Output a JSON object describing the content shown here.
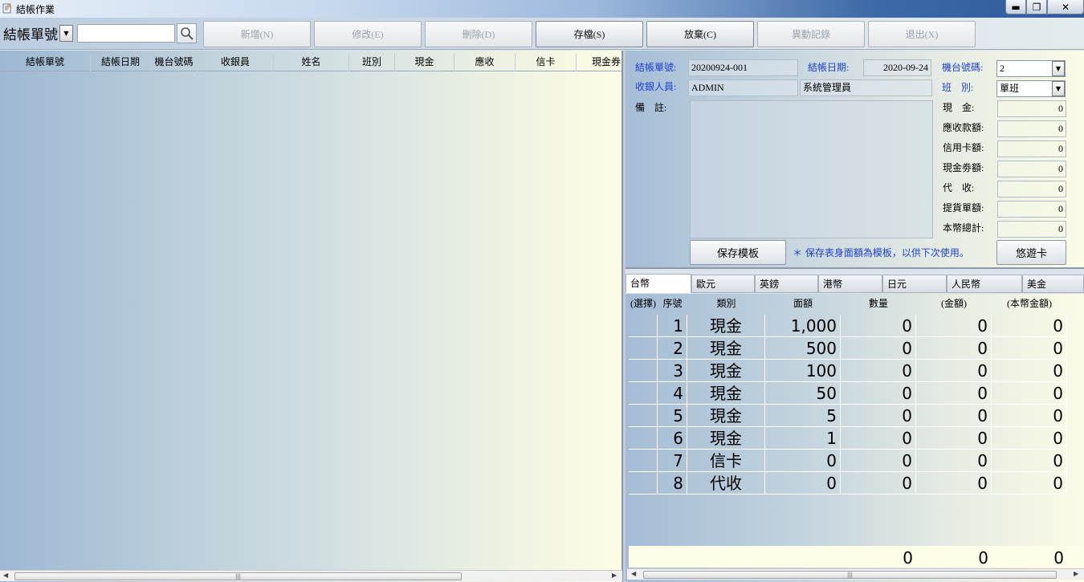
{
  "window": {
    "title": "結帳作業"
  },
  "toolbar": {
    "search_field": "結帳單號",
    "search_value": "",
    "buttons": [
      {
        "label": "新增(N)",
        "enabled": false
      },
      {
        "label": "修改(E)",
        "enabled": false
      },
      {
        "label": "刪除(D)",
        "enabled": false
      },
      {
        "label": "存檔(S)",
        "enabled": true
      },
      {
        "label": "放棄(C)",
        "enabled": true
      },
      {
        "label": "異動記錄",
        "enabled": false
      },
      {
        "label": "退出(X)",
        "enabled": false
      }
    ]
  },
  "list": {
    "columns": [
      "結帳單號",
      "結帳日期",
      "機台號碼",
      "收銀員",
      "姓名",
      "班別",
      "現金",
      "應收",
      "信卡",
      "現金券"
    ]
  },
  "form": {
    "bill_no_label": "結帳單號:",
    "bill_no": "20200924-001",
    "date_label": "結帳日期:",
    "date": "2020-09-24",
    "machine_label": "機台號碼:",
    "machine": "2",
    "cashier_label": "收銀人員:",
    "cashier_id": "ADMIN",
    "cashier_name": "系統管理員",
    "shift_label": "班　別:",
    "shift": "單班",
    "memo_label": "備　註:",
    "memo": "",
    "totals": [
      {
        "label": "現　金:",
        "value": "0"
      },
      {
        "label": "應收款額:",
        "value": "0"
      },
      {
        "label": "信用卡額:",
        "value": "0"
      },
      {
        "label": "現金劵額:",
        "value": "0"
      },
      {
        "label": "代　收:",
        "value": "0"
      },
      {
        "label": "提貨單額:",
        "value": "0"
      },
      {
        "label": "本幣總計:",
        "value": "0"
      }
    ],
    "save_template_label": "保存模板",
    "note": "＊ 保存表身面額為模板，以供下次使用。",
    "easycard_label": "悠遊卡"
  },
  "tabs": [
    "台幣",
    "歐元",
    "英鎊",
    "港幣",
    "日元",
    "人民幣",
    "美金"
  ],
  "detail": {
    "columns": [
      "(選擇)",
      "序號",
      "類別",
      "面額",
      "數量",
      "(金額)",
      "(本幣金額)"
    ],
    "rows": [
      {
        "seq": "1",
        "type": "現金",
        "denom": "1,000",
        "qty": "0",
        "amount": "0",
        "local": "0"
      },
      {
        "seq": "2",
        "type": "現金",
        "denom": "500",
        "qty": "0",
        "amount": "0",
        "local": "0"
      },
      {
        "seq": "3",
        "type": "現金",
        "denom": "100",
        "qty": "0",
        "amount": "0",
        "local": "0"
      },
      {
        "seq": "4",
        "type": "現金",
        "denom": "50",
        "qty": "0",
        "amount": "0",
        "local": "0"
      },
      {
        "seq": "5",
        "type": "現金",
        "denom": "5",
        "qty": "0",
        "amount": "0",
        "local": "0"
      },
      {
        "seq": "6",
        "type": "現金",
        "denom": "1",
        "qty": "0",
        "amount": "0",
        "local": "0"
      },
      {
        "seq": "7",
        "type": "信卡",
        "denom": "0",
        "qty": "0",
        "amount": "0",
        "local": "0"
      },
      {
        "seq": "8",
        "type": "代收",
        "denom": "0",
        "qty": "0",
        "amount": "0",
        "local": "0"
      }
    ],
    "summary": {
      "qty": "0",
      "amount": "0",
      "local": "0"
    }
  }
}
